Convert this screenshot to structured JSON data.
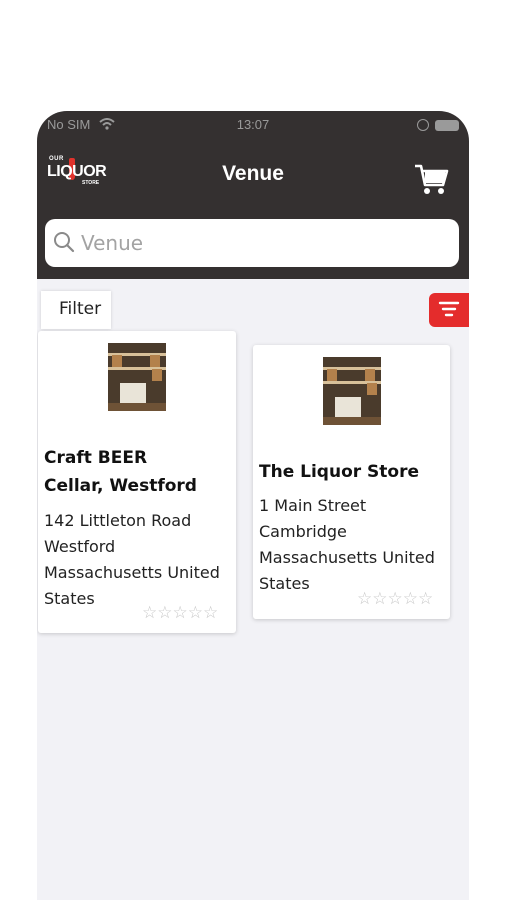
{
  "status_bar": {
    "carrier": "No SIM",
    "time": "13:07"
  },
  "header": {
    "title": "Venue",
    "logo": {
      "top": "OUR",
      "main": "LIQUOR",
      "bottom": "STORE"
    }
  },
  "search": {
    "placeholder": "Venue",
    "value": ""
  },
  "filter": {
    "label": "Filter"
  },
  "venues": [
    {
      "name_lines": [
        "Craft BEER",
        "Cellar, Westford"
      ],
      "address_lines": [
        "142 Littleton Road",
        "Westford",
        "Massachusetts United",
        "States"
      ],
      "rating": 0,
      "max_rating": 5
    },
    {
      "name_lines": [
        "The Liquor Store"
      ],
      "address_lines": [
        "1 Main Street",
        "Cambridge",
        "Massachusetts United",
        "States"
      ],
      "rating": 0,
      "max_rating": 5
    }
  ],
  "icons": {
    "search": "search-icon",
    "cart": "cart-icon",
    "filter": "filter-icon",
    "star": "star-outline-icon"
  },
  "colors": {
    "header_bg": "#343030",
    "accent_red": "#e42c2c",
    "page_bg": "#f2f2f6",
    "star_empty": "#c8c8c8"
  }
}
